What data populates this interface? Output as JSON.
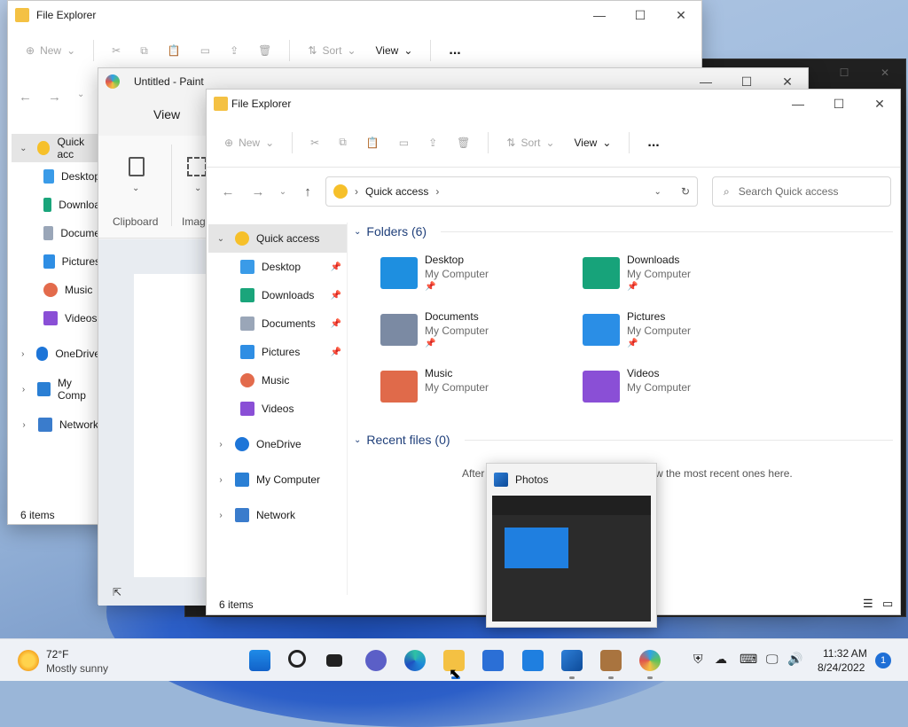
{
  "back_explorer": {
    "title": "File Explorer",
    "toolbar": {
      "new": "New",
      "sort": "Sort",
      "view": "View",
      "more": "..."
    },
    "sidebar": [
      "Quick acc",
      "Desktop",
      "Downloa",
      "Docume",
      "Pictures",
      "Music",
      "Videos",
      "OneDrive",
      "My Comp",
      "Network"
    ],
    "status": "6 items"
  },
  "paint": {
    "title": "Untitled - Paint",
    "view_tab": "View",
    "clipboard": "Clipboard",
    "image": "Imag"
  },
  "explorer": {
    "title": "File Explorer",
    "toolbar": {
      "new": "New",
      "sort": "Sort",
      "view": "View",
      "more": "..."
    },
    "address": "Quick access",
    "search_placeholder": "Search Quick access",
    "sidebar": {
      "quick_access": "Quick access",
      "items": [
        "Desktop",
        "Downloads",
        "Documents",
        "Pictures",
        "Music",
        "Videos"
      ],
      "onedrive": "OneDrive",
      "computer": "My Computer",
      "network": "Network"
    },
    "folders_header": "Folders (6)",
    "folders": [
      {
        "name": "Desktop",
        "location": "My Computer",
        "pinned": true,
        "color": "#1e8fe0"
      },
      {
        "name": "Downloads",
        "location": "My Computer",
        "pinned": true,
        "color": "#17a37a"
      },
      {
        "name": "Documents",
        "location": "My Computer",
        "pinned": true,
        "color": "#7b8aa3"
      },
      {
        "name": "Pictures",
        "location": "My Computer",
        "pinned": true,
        "color": "#2a8ee6"
      },
      {
        "name": "Music",
        "location": "My Computer",
        "pinned": false,
        "color": "#e06a4a"
      },
      {
        "name": "Videos",
        "location": "My Computer",
        "pinned": false,
        "color": "#8a4fd6"
      }
    ],
    "recent_header": "Recent files (0)",
    "recent_empty_left": "After",
    "recent_empty_right": "w the most recent ones here.",
    "status": "6 items"
  },
  "photos_thumb": {
    "title": "Photos"
  },
  "taskbar": {
    "weather_temp": "72°F",
    "weather_desc": "Mostly sunny",
    "time": "11:32 AM",
    "date": "8/24/2022",
    "notifications": "1"
  }
}
